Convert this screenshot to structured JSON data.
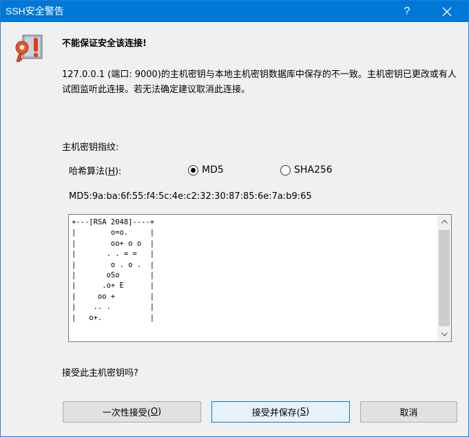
{
  "window": {
    "title": "SSH安全警告",
    "help_label": "?",
    "close_label": "×"
  },
  "content": {
    "heading": "不能保证安全该连接!",
    "message": "127.0.0.1 (端口: 9000)的主机密钥与本地主机密钥数据库中保存的不一致。主机密钥已更改或有人试图监听此连接。若无法确定建议取消此连接。",
    "fingerprint_label": "主机密钥指纹:",
    "hash_label_prefix": "哈希算法(",
    "hash_label_key": "H",
    "hash_label_suffix": "):",
    "radio_md5": "MD5",
    "radio_sha256": "SHA256",
    "selected_algorithm": "MD5",
    "fingerprint_value": "MD5:9a:ba:6f:55:f4:5c:4e:c2:32:30:87:85:6e:7a:b9:65",
    "randomart": "+---[RSA 2048]----+\n|        o=o.     |\n|        oo+ o o  |\n|       . . = =   |\n|        o . o .  |\n|       oSo       |\n|      .o+ E      |\n|     oo +        |\n|    .. .         |\n|   o+.           |",
    "question": "接受此主机密钥吗?"
  },
  "buttons": {
    "accept_once_text": "一次性接受(",
    "accept_once_key": "O",
    "accept_save_text": "接受并保存(",
    "accept_save_key": "S",
    "paren_close": ")",
    "cancel": "取消"
  },
  "colors": {
    "titlebar": "#0078d7",
    "default_button_border": "#0078d7",
    "window_bg": "#f0f0f0"
  }
}
